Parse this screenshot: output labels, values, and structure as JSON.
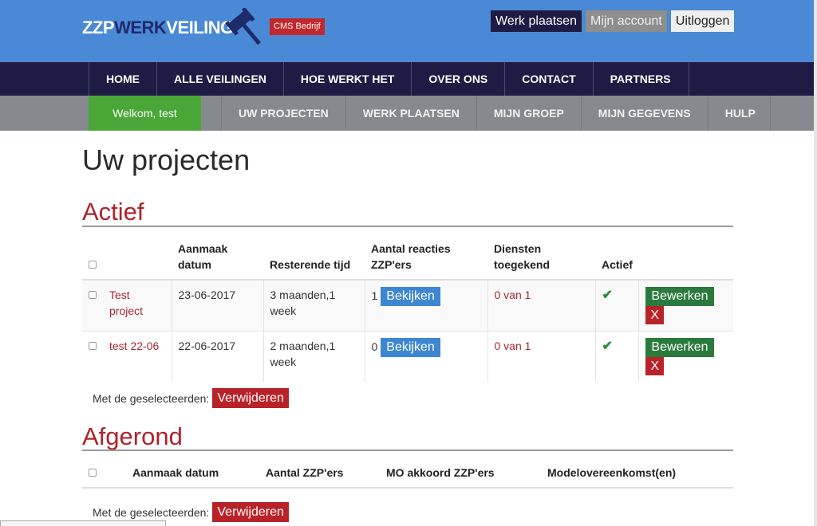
{
  "header": {
    "logo_part1": "ZZP",
    "logo_part2": "WERK",
    "logo_part3": "VEILING",
    "logo_icon": "gavel-icon",
    "badge": "CMS Bedrijf",
    "top_links": [
      "Werk plaatsen",
      "Mijn account",
      "Uitloggen"
    ]
  },
  "main_nav": [
    "HOME",
    "ALLE VEILINGEN",
    "HOE WERKT HET",
    "OVER ONS",
    "CONTACT",
    "PARTNERS"
  ],
  "sub_nav": {
    "welcome": "Welkom, test",
    "items": [
      "UW PROJECTEN",
      "WERK PLAATSEN",
      "MIJN GROEP",
      "MIJN GEGEVENS",
      "HULP"
    ]
  },
  "page": {
    "title": "Uw projecten"
  },
  "active": {
    "title": "Actief",
    "columns": [
      "",
      "",
      "Aanmaak datum",
      "Resterende tijd",
      "Aantal reacties ZZP'ers",
      "Diensten toegekend",
      "Actief",
      ""
    ],
    "columns_html_breaks": {
      "aanmaak": [
        "Aanmaak",
        "datum"
      ],
      "reacties": [
        "Aantal reacties",
        "ZZP'ers"
      ],
      "diensten": [
        "Diensten",
        "toegekend"
      ]
    },
    "rows": [
      {
        "name": "Test project",
        "date": "23-06-2017",
        "remaining": "3 maanden,1 week",
        "reactions": "1",
        "view_label": "Bekijken",
        "assigned": "0 van 1",
        "active_icon": "check-icon",
        "edit_label": "Bewerken",
        "delete_label": "X"
      },
      {
        "name": "test 22-06",
        "date": "22-06-2017",
        "remaining": "2 maanden,1 week",
        "reactions": "0",
        "view_label": "Bekijken",
        "assigned": "0 van 1",
        "active_icon": "check-icon",
        "edit_label": "Bewerken",
        "delete_label": "X"
      }
    ],
    "bulk_label": "Met de geselecteerden:",
    "bulk_button": "Verwijderen"
  },
  "done": {
    "title": "Afgerond",
    "columns": [
      "Aanmaak datum",
      "Aantal ZZP'ers",
      "MO akkoord ZZP'ers",
      "Modelovereenkomst(en)"
    ],
    "bulk_label": "Met de geselecteerden:",
    "bulk_button": "Verwijderen"
  },
  "colors": {
    "header_blue": "#4a89d6",
    "nav_dark": "#1e1c44",
    "subnav_gray": "#868a8f",
    "welcome_green": "#4aa636",
    "accent_red": "#b0222a",
    "button_blue": "#3d86d2",
    "button_green": "#2b7a3d"
  }
}
